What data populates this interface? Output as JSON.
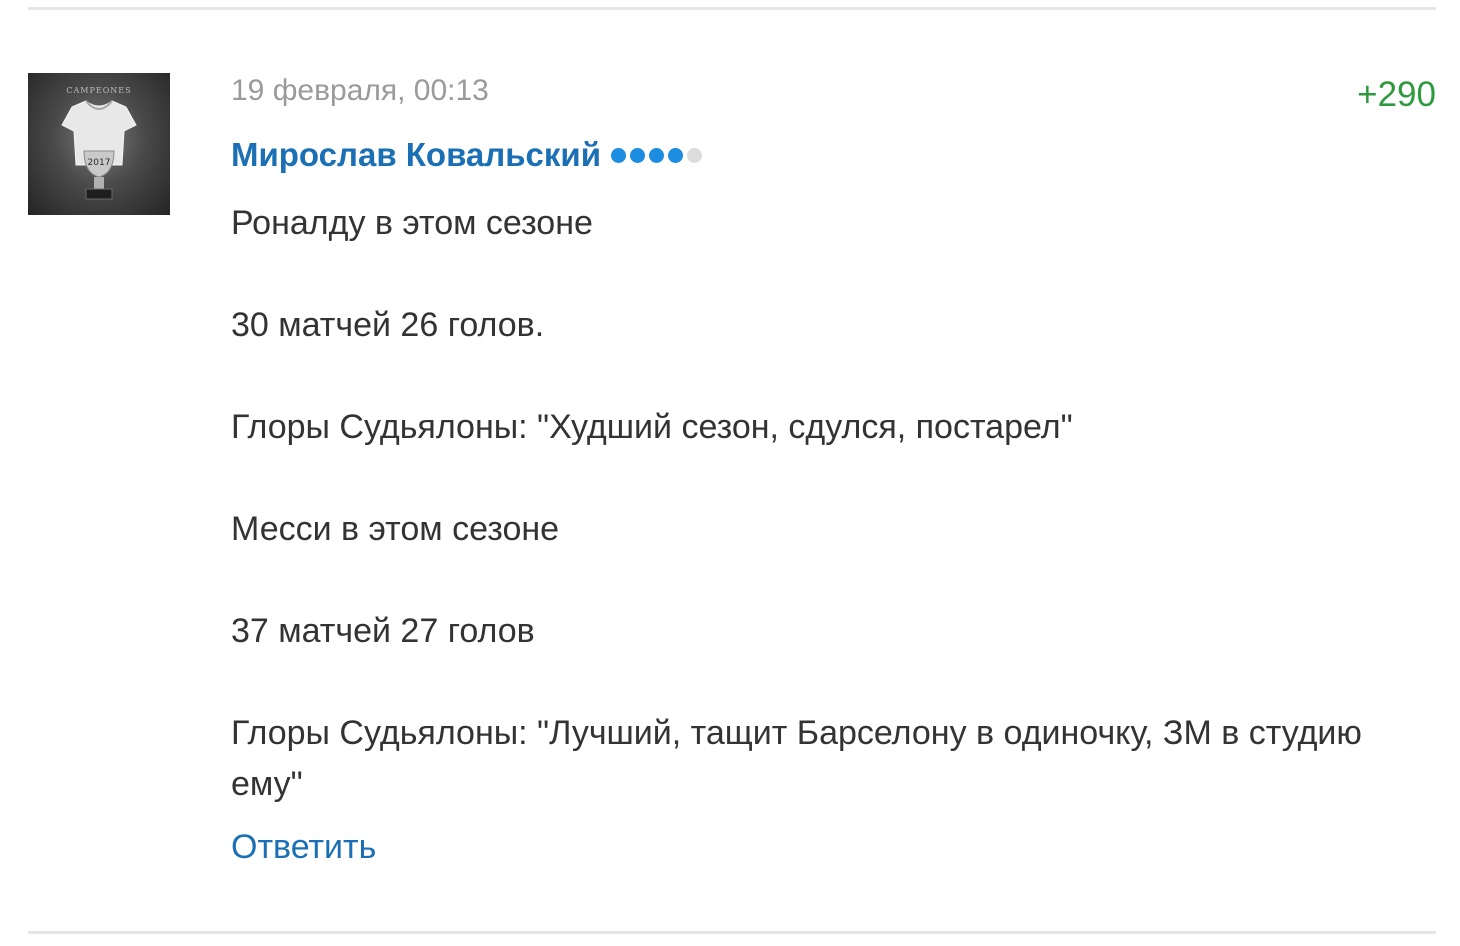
{
  "comment": {
    "date": "19 февраля, 00:13",
    "score": "+290",
    "author": "Мирослав Ковальский",
    "rank": {
      "filled": 4,
      "total": 5,
      "filled_color": "#1c8de0",
      "empty_color": "#dcdcdc"
    },
    "avatar_icon": "user-avatar-image",
    "paragraphs": [
      "Роналду в этом сезоне",
      "30 матчей 26 голов.",
      "Глоры Судьялоны: \"Худший сезон, сдулся, постарел\"",
      "Месси в этом сезоне",
      "37 матчей 27 голов",
      "Глоры Судьялоны: \"Лучший, тащит Барселону в одиночку, ЗМ в студию ему\""
    ],
    "reply_label": "Ответить"
  },
  "colors": {
    "author": "#1b70b5",
    "score_positive": "#2e9a3e",
    "date": "#9a9a9a",
    "text": "#333333"
  }
}
